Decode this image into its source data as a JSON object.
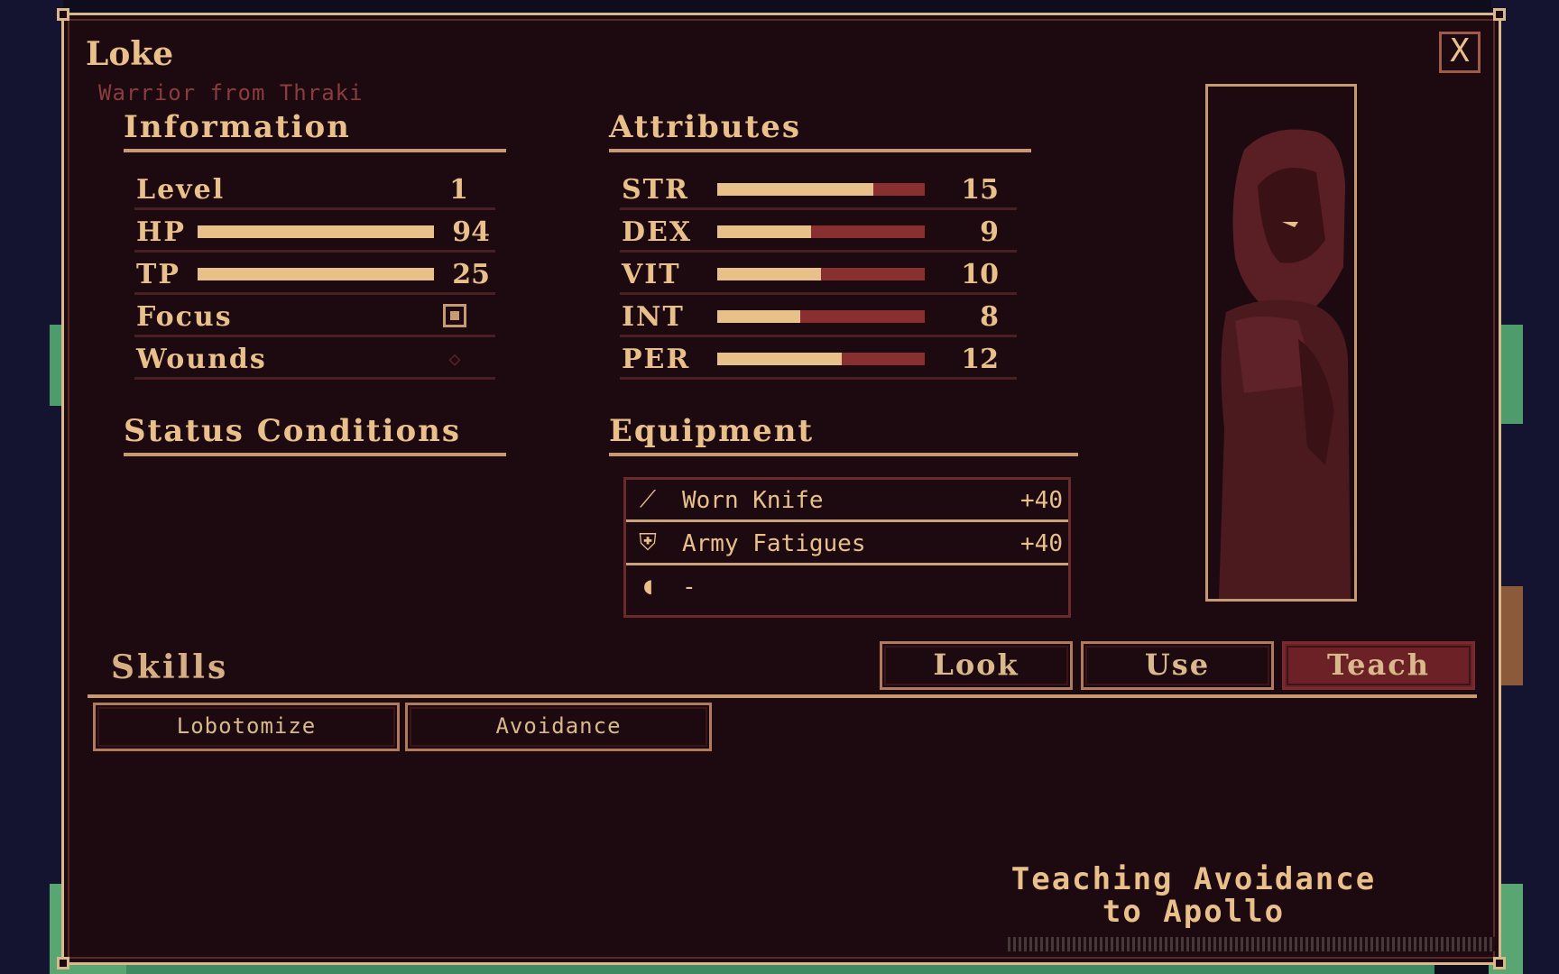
{
  "character": {
    "name": "Loke",
    "subtitle": "Warrior from Thraki"
  },
  "close_label": "X",
  "information": {
    "title": "Information",
    "level_label": "Level",
    "level_value": "1",
    "hp_label": "HP",
    "hp_value": "94",
    "hp_fill": 1.0,
    "tp_label": "TP",
    "tp_value": "25",
    "tp_fill": 1.0,
    "focus_label": "Focus",
    "focus_checked": true,
    "wounds_label": "Wounds",
    "wounds_icon": "wound-diamond-icon"
  },
  "attributes": {
    "title": "Attributes",
    "items": [
      {
        "label": "STR",
        "value": "15",
        "fill": 0.75
      },
      {
        "label": "DEX",
        "value": "9",
        "fill": 0.45
      },
      {
        "label": "VIT",
        "value": "10",
        "fill": 0.5
      },
      {
        "label": "INT",
        "value": "8",
        "fill": 0.4
      },
      {
        "label": "PER",
        "value": "12",
        "fill": 0.6
      }
    ]
  },
  "status_conditions": {
    "title": "Status Conditions"
  },
  "equipment": {
    "title": "Equipment",
    "items": [
      {
        "icon": "knife-icon",
        "name": "Worn Knife",
        "bonus": "+40"
      },
      {
        "icon": "armor-icon",
        "name": "Army Fatigues",
        "bonus": "+40"
      },
      {
        "icon": "accessory-icon",
        "name": "-",
        "bonus": ""
      }
    ]
  },
  "skills": {
    "title": "Skills",
    "items": [
      "Lobotomize",
      "Avoidance"
    ]
  },
  "actions": {
    "look": "Look",
    "use": "Use",
    "teach": "Teach",
    "active": "teach"
  },
  "message": {
    "line1": "Teaching Avoidance",
    "line2": "to Apollo"
  },
  "colors": {
    "panel_bg": "#1d0910",
    "text": "#e9c08a",
    "bar_fill": "#e7c189",
    "bar_track": "#8a2f2f",
    "active_button": "#6b2126"
  }
}
